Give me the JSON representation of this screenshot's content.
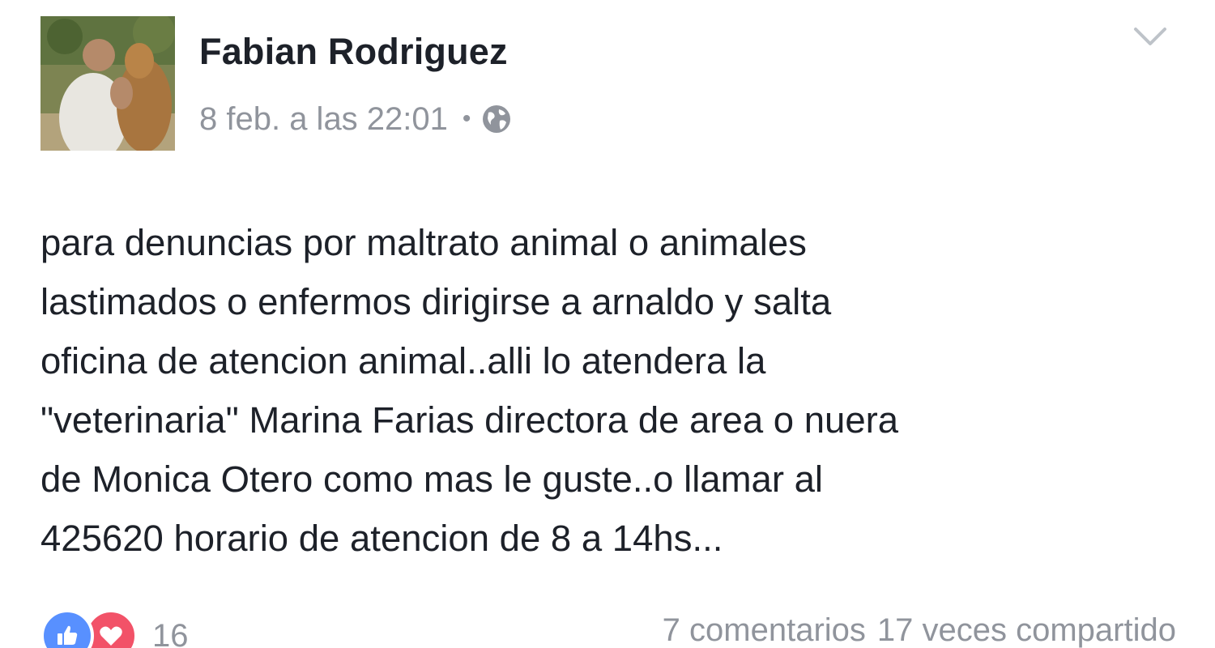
{
  "post": {
    "author": "Fabian Rodriguez",
    "timestamp": "8 feb. a las 22:01",
    "separator": "•",
    "privacy_icon": "globe-icon",
    "menu_icon": "chevron-down-icon",
    "text": "para denuncias por maltrato animal o animales\nlastimados o enfermos dirigirse a arnaldo y salta\noficina de atencion animal..alli lo atendera la\n\"veterinaria\" Marina Farias directora de area o nuera\nde Monica Otero como mas le guste..o llamar al\n425620 horario de atencion de 8 a 14hs..."
  },
  "footer": {
    "reactions": [
      "like-icon",
      "love-icon"
    ],
    "reaction_count": "16",
    "comments": "7 comentarios",
    "shares": "17 veces compartido"
  },
  "colors": {
    "text": "#1d2129",
    "muted": "#90949c",
    "like": "#5890ff",
    "love": "#f25268"
  }
}
